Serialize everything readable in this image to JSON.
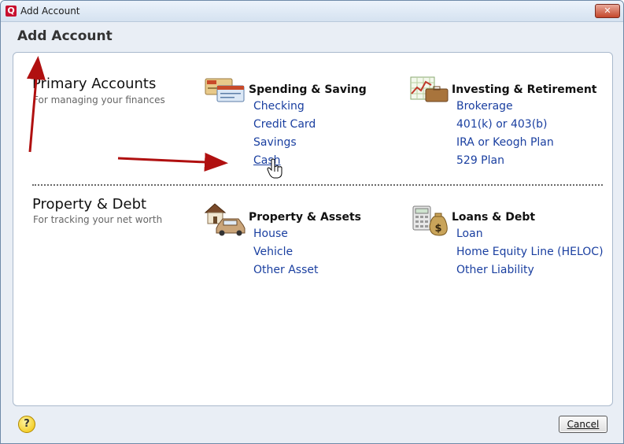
{
  "window": {
    "title": "Add Account",
    "close_label": "✕"
  },
  "dialog": {
    "title": "Add Account"
  },
  "primary": {
    "title": "Primary Accounts",
    "subtitle": "For managing your finances",
    "spending": {
      "title": "Spending & Saving",
      "items": [
        "Checking",
        "Credit Card",
        "Savings",
        "Cash"
      ]
    },
    "investing": {
      "title": "Investing & Retirement",
      "items": [
        "Brokerage",
        "401(k) or 403(b)",
        "IRA or Keogh Plan",
        "529 Plan"
      ]
    }
  },
  "property": {
    "title": "Property & Debt",
    "subtitle": "For tracking your net worth",
    "assets": {
      "title": "Property & Assets",
      "items": [
        "House",
        "Vehicle",
        "Other Asset"
      ]
    },
    "loans": {
      "title": "Loans & Debt",
      "items": [
        "Loan",
        "Home Equity Line (HELOC)",
        "Other Liability"
      ]
    }
  },
  "footer": {
    "help_label": "?",
    "cancel_label": "Cancel"
  },
  "colors": {
    "link": "#1a3fa0",
    "annotation_arrow": "#b01010"
  },
  "icons": [
    "app-logo-icon",
    "checkbook-icon",
    "stock-chart-icon",
    "house-car-icon",
    "calculator-money-icon",
    "hand-cursor-icon"
  ]
}
